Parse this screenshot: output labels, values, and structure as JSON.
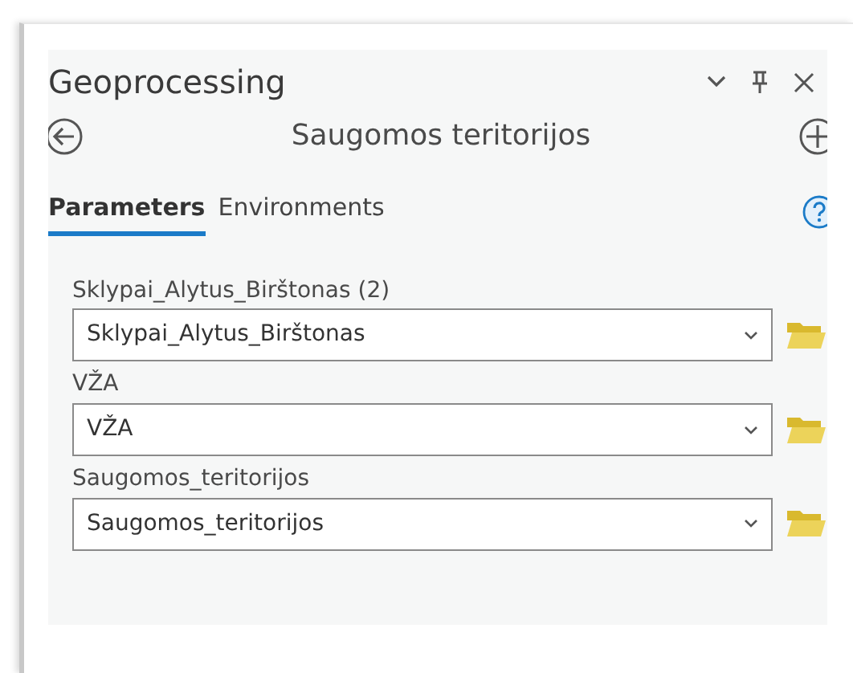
{
  "pane": {
    "title": "Geoprocessing"
  },
  "tool": {
    "title": "Saugomos teritorijos"
  },
  "tabs": [
    {
      "label": "Parameters",
      "selected": true
    },
    {
      "label": "Environments",
      "selected": false
    }
  ],
  "parameters": [
    {
      "label": "Sklypai_Alytus_Birštonas (2)",
      "value": "Sklypai_Alytus_Birštonas"
    },
    {
      "label": "VŽA",
      "value": "VŽA"
    },
    {
      "label": "Saugomos_teritorijos",
      "value": "Saugomos_teritorijos"
    }
  ]
}
